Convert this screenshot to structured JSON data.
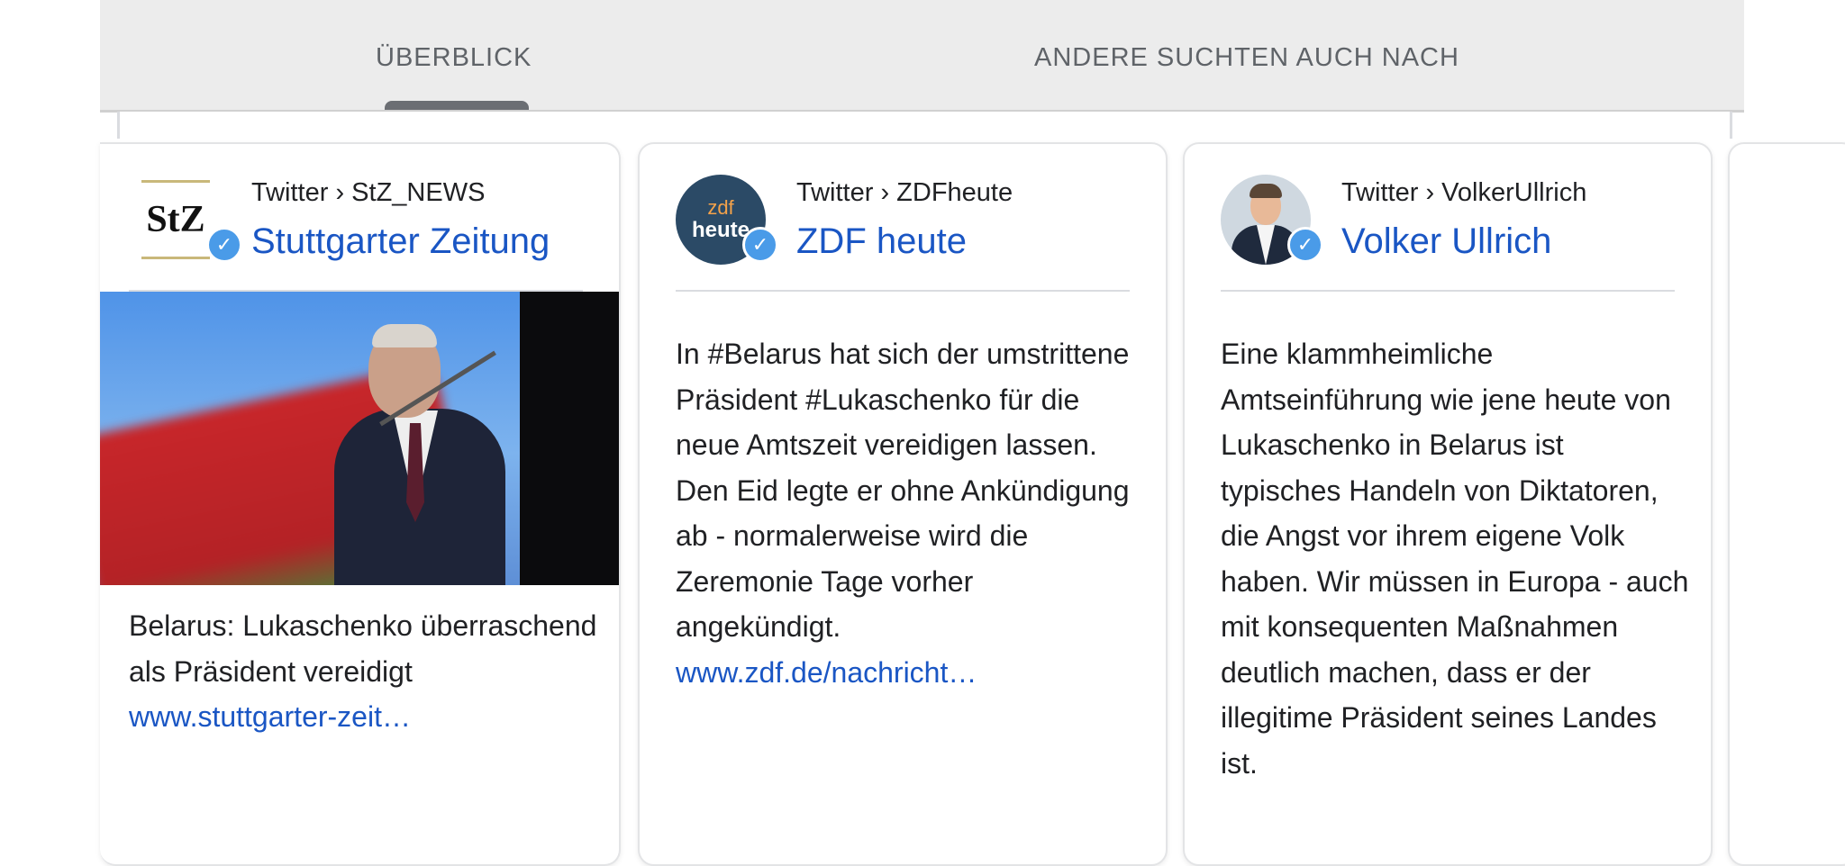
{
  "tabs": {
    "overview": "ÜBERBLICK",
    "related": "ANDERE SUCHTEN AUCH NACH"
  },
  "cards": [
    {
      "source": "Twitter › StZ_NEWS",
      "title": "Stuttgarter Zeitung",
      "logo_text": "StZ",
      "text": "Belarus: Lukaschenko überraschend als Präsident vereidigt",
      "link": "www.stuttgarter-zeit…"
    },
    {
      "source": "Twitter › ZDFheute",
      "title": "ZDF heute",
      "logo_text_top": "zdf",
      "logo_text_bottom": "heute",
      "text": "In #Belarus hat sich der umstrittene Präsident #Lukaschenko für die neue Amtszeit vereidigen lassen. Den Eid legte er ohne Ankündigung ab - normalerweise wird die Zeremonie Tage vorher angekündigt.",
      "link": "www.zdf.de/nachricht…"
    },
    {
      "source": "Twitter › VolkerUllrich",
      "title": "Volker Ullrich",
      "text": "Eine klammheimliche Amtseinführung wie jene heute von Lukaschenko in Belarus ist typisches Handeln von Diktatoren, die Angst vor ihrem eigene Volk haben. Wir müssen in Europa - auch mit konsequenten Maßnahmen deutlich machen, dass er der illegitime Präsident seines Landes ist."
    }
  ],
  "icons": {
    "verified": "verified-check-icon"
  },
  "colors": {
    "link": "#1a56c4",
    "verified": "#4a9be8",
    "tab_bar": "#ececec"
  }
}
